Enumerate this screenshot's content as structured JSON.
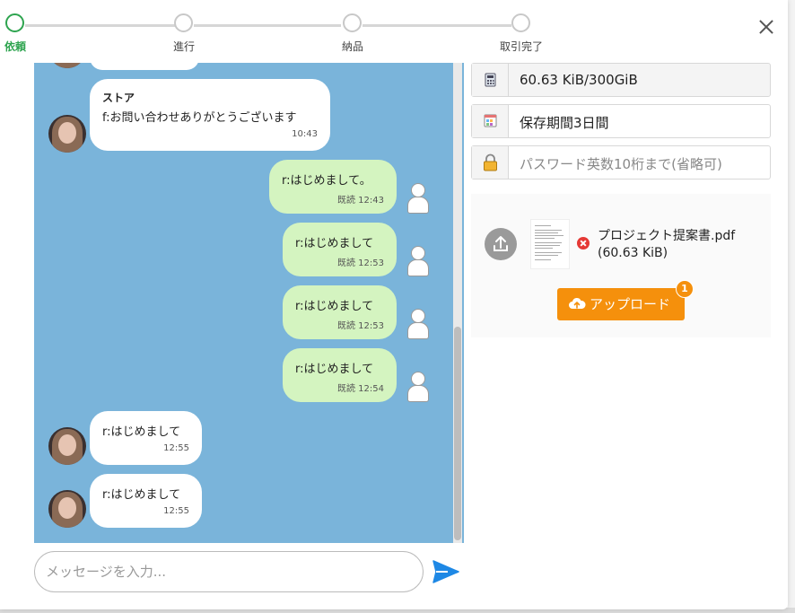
{
  "stepper": {
    "steps": [
      {
        "label": "依頼",
        "active": true
      },
      {
        "label": "進行",
        "active": false
      },
      {
        "label": "納品",
        "active": false
      },
      {
        "label": "取引完了",
        "active": false
      }
    ],
    "active_color": "#2ea44f"
  },
  "chat": {
    "background_color": "#7ab4da",
    "messages": [
      {
        "side": "left",
        "sender": "ストア",
        "text": "f:お問い合わせありがとうございます",
        "time": "10:43"
      },
      {
        "side": "right",
        "text": "r:はじめまして。",
        "time": "既読 12:43"
      },
      {
        "side": "right",
        "text": "r:はじめまして",
        "time": "既読 12:53"
      },
      {
        "side": "right",
        "text": "r:はじめまして",
        "time": "既読 12:53"
      },
      {
        "side": "right",
        "text": "r:はじめまして",
        "time": "既読 12:54"
      },
      {
        "side": "left",
        "text": "r:はじめまして",
        "time": "12:55"
      },
      {
        "side": "left",
        "text": "r:はじめまして",
        "time": "12:55"
      }
    ],
    "input_placeholder": "メッセージを入力..."
  },
  "side_panel": {
    "capacity": "60.63 KiB/300GiB",
    "retention": "保存期間3日間",
    "password_placeholder": "パスワード英数10桁まで(省略可)",
    "file": {
      "name": "プロジェクト提案書.pdf",
      "size": "(60.63 KiB)"
    },
    "upload_button": "アップロード",
    "upload_count": "1",
    "accent_color": "#f5900c"
  }
}
